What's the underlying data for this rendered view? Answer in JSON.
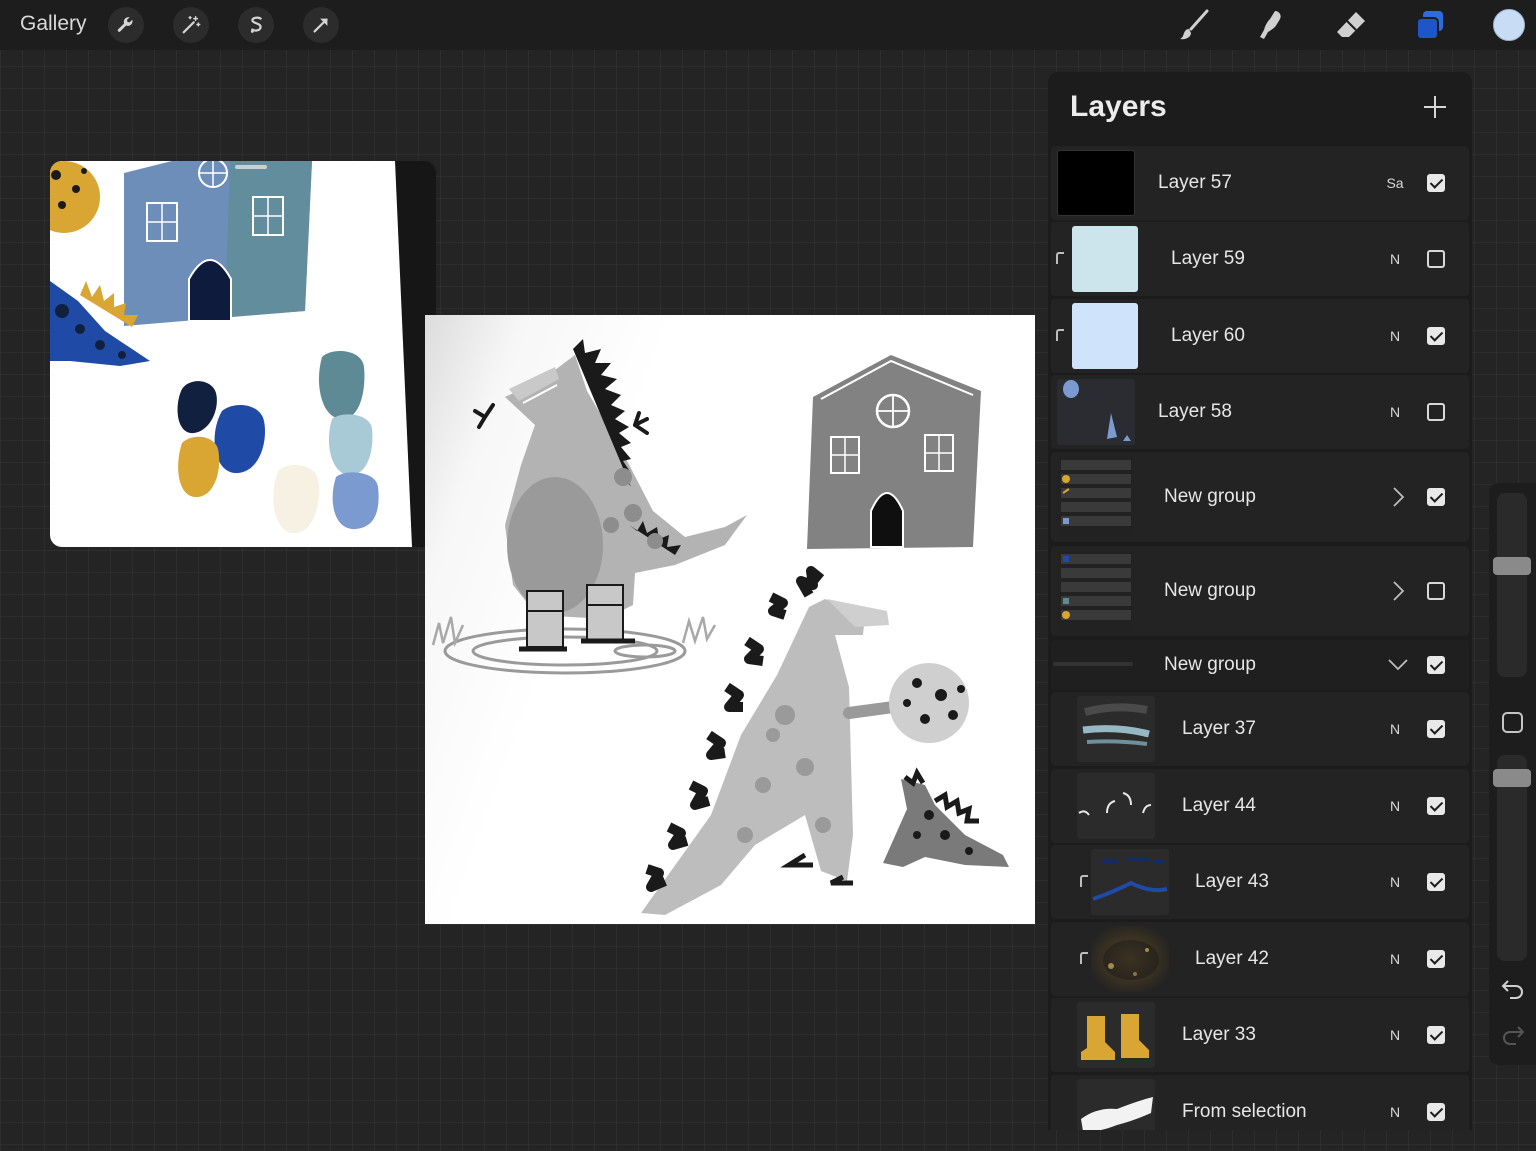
{
  "topbar": {
    "gallery_label": "Gallery",
    "left_tools": [
      "wrench-icon",
      "magic-wand-icon",
      "selection-s-icon",
      "transform-arrow-icon"
    ],
    "right_tools": [
      "brush-icon",
      "smudge-icon",
      "eraser-icon",
      "layers-icon"
    ],
    "active_tool": "layers-icon",
    "current_color": "#c9dcf6"
  },
  "layers": {
    "title": "Layers",
    "items": [
      {
        "name": "Layer 57",
        "blend": "Sa",
        "visible": true,
        "thumb": "black-fill",
        "clipped": false,
        "indent": 0
      },
      {
        "name": "Layer 59",
        "blend": "N",
        "visible": false,
        "thumb": "light-cyan-fill",
        "clipped": true,
        "indent": 1
      },
      {
        "name": "Layer 60",
        "blend": "N",
        "visible": true,
        "thumb": "light-blue-fill",
        "clipped": true,
        "indent": 1
      },
      {
        "name": "Layer 58",
        "blend": "N",
        "visible": false,
        "thumb": "blue-shapes",
        "clipped": false,
        "indent": 0
      },
      {
        "name": "New group",
        "blend": "",
        "visible": true,
        "thumb": "group-preview",
        "type": "group-collapsed"
      },
      {
        "name": "New group",
        "blend": "",
        "visible": false,
        "thumb": "group-preview",
        "type": "group-collapsed"
      },
      {
        "name": "New group",
        "blend": "",
        "visible": true,
        "thumb": "none",
        "type": "group-expanded"
      },
      {
        "name": "Layer 37",
        "blend": "N",
        "visible": true,
        "thumb": "blue-strokes",
        "clipped": false,
        "indent": 1
      },
      {
        "name": "Layer 44",
        "blend": "N",
        "visible": true,
        "thumb": "white-arcs",
        "clipped": false,
        "indent": 1
      },
      {
        "name": "Layer 43",
        "blend": "N",
        "visible": true,
        "thumb": "navy-lines",
        "clipped": true,
        "indent": 2
      },
      {
        "name": "Layer 42",
        "blend": "N",
        "visible": true,
        "thumb": "gold-texture",
        "clipped": true,
        "indent": 2
      },
      {
        "name": "Layer 33",
        "blend": "N",
        "visible": true,
        "thumb": "yellow-boots",
        "clipped": false,
        "indent": 1
      },
      {
        "name": "From selection",
        "blend": "N",
        "visible": true,
        "thumb": "white-shape",
        "clipped": false,
        "indent": 1
      }
    ]
  },
  "reference_palette": [
    "#11203f",
    "#1f4aa5",
    "#d9a533",
    "#f7f1e4",
    "#5e8a95",
    "#a8c9d6",
    "#7b9bd0"
  ]
}
